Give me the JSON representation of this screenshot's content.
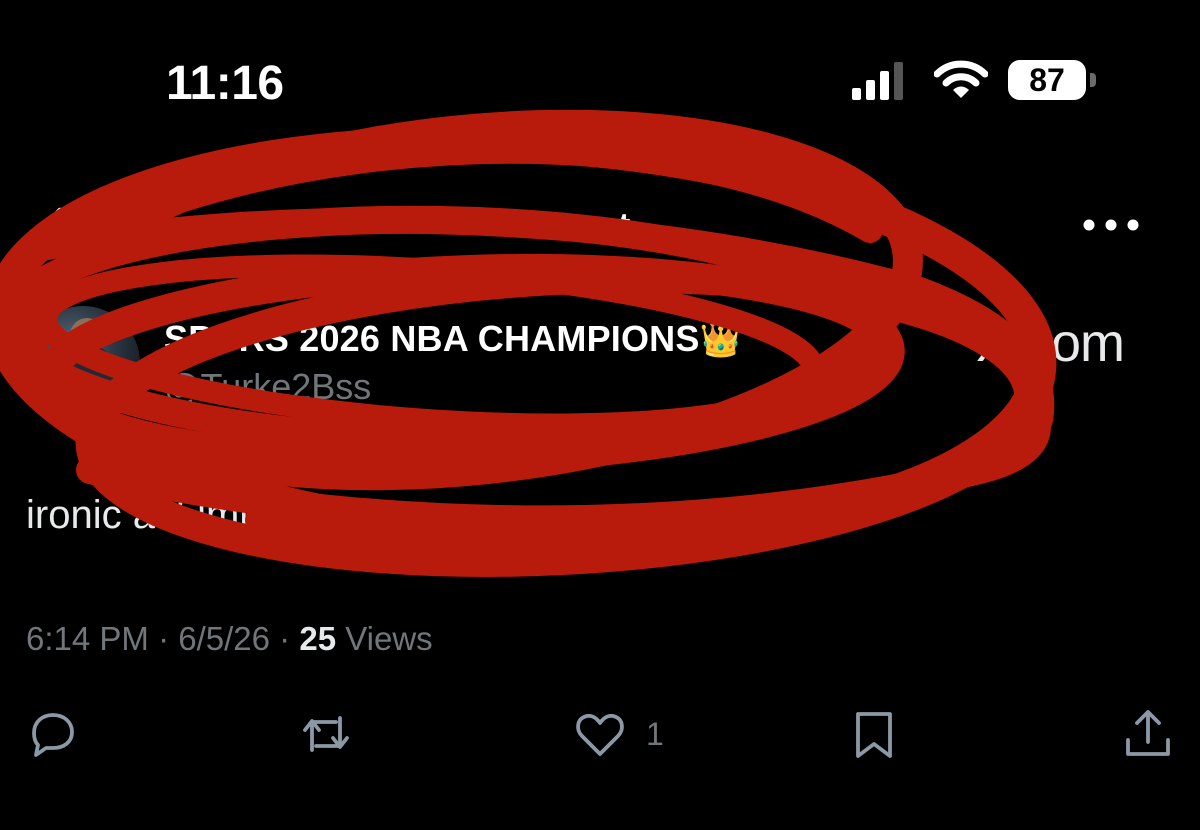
{
  "status_bar": {
    "time": "11:16",
    "battery": "87"
  },
  "nav": {
    "title": "Post"
  },
  "author": {
    "display_name": "SPURS 2026 NBA CHAMPIONS",
    "display_emoji": "👑",
    "handle": "@Turke2Bss"
  },
  "watermark": "X.com",
  "post": {
    "text": "ironic asf lmk",
    "emoji": "😭"
  },
  "meta": {
    "time": "6:14 PM",
    "separator": "·",
    "date": "6/5/26",
    "views_count": "25",
    "views_label": "Views"
  },
  "actions": {
    "reply_icon": "reply-icon",
    "repost_icon": "repost-icon",
    "like_icon": "heart-icon",
    "like_count": "1",
    "bookmark_icon": "bookmark-icon",
    "share_icon": "share-icon"
  },
  "colors": {
    "background": "#000000",
    "text": "#e7e9ea",
    "muted": "#71767b",
    "scribble": "#b81a0c"
  }
}
